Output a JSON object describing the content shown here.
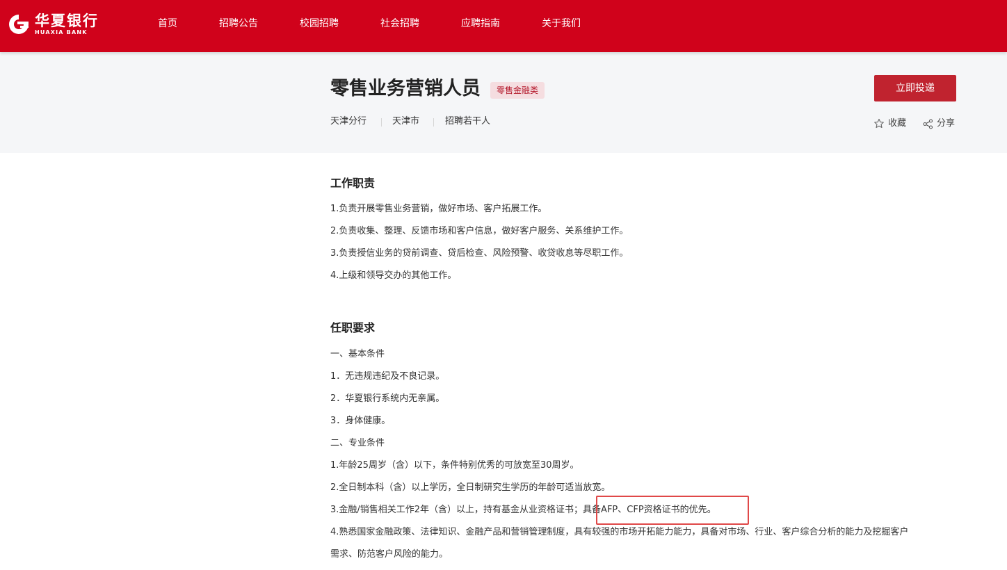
{
  "brand": {
    "name_cn": "华夏银行",
    "name_en": "HUAXIA BANK",
    "color": "#d0021b"
  },
  "nav": {
    "items": [
      "首页",
      "招聘公告",
      "校园招聘",
      "社会招聘",
      "应聘指南",
      "关于我们"
    ]
  },
  "job": {
    "title": "零售业务营销人员",
    "tag": "零售金融类",
    "branch": "天津分行",
    "city": "天津市",
    "headcount": "招聘若干人",
    "apply_label": "立即投递",
    "favorite_label": "收藏",
    "share_label": "分享"
  },
  "duties": {
    "title": "工作职责",
    "lines": [
      "1.负责开展零售业务营销，做好市场、客户拓展工作。",
      "2.负责收集、整理、反馈市场和客户信息，做好客户服务、关系维护工作。",
      "3.负责授信业务的贷前调查、贷后检查、风险预警、收贷收息等尽职工作。",
      "4.上级和领导交办的其他工作。"
    ]
  },
  "requirements": {
    "title": "任职要求",
    "lines": [
      "一、基本条件",
      "1．无违规违纪及不良记录。",
      "2．华夏银行系统内无亲属。",
      "3．身体健康。",
      "二、专业条件",
      "1.年龄25周岁（含）以下，条件特别优秀的可放宽至30周岁。",
      "2.全日制本科（含）以上学历，全日制研究生学历的年龄可适当放宽。",
      "3.金融/销售相关工作2年（含）以上，持有基金从业资格证书；具备AFP、CFP资格证书的优先。",
      "4.熟悉国家金融政策、法律知识、金融产品和营销管理制度，具有较强的市场开拓能力能力，具备对市场、行业、客户综合分析的能力及挖掘客户",
      "需求、防范客户风险的能力。"
    ]
  },
  "colors": {
    "primary": "#d0021b",
    "button": "#c0232f",
    "tag_bg": "#f5dde0",
    "tag_text": "#b3172a",
    "highlight": "#e04848"
  }
}
